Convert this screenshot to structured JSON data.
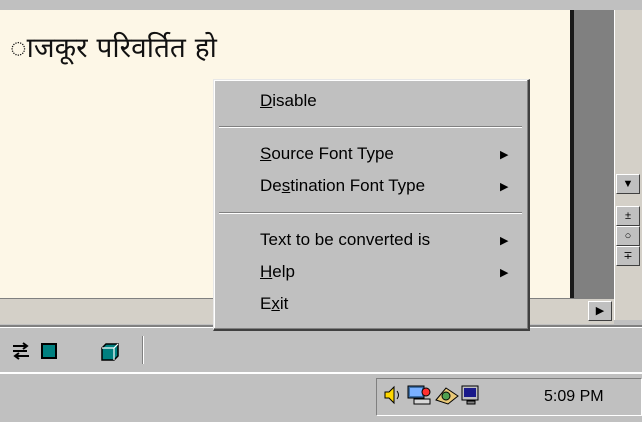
{
  "document": {
    "text": "ाजकूर परिवर्तित हो"
  },
  "context_menu": {
    "items": [
      {
        "label": "Disable",
        "submenu": false
      },
      {
        "label": "Source Font Type",
        "submenu": true
      },
      {
        "label": "Destination Font Type",
        "submenu": true
      },
      {
        "label": "Text to be converted is",
        "submenu": true
      },
      {
        "label": "Help",
        "submenu": true
      },
      {
        "label": "Exit",
        "submenu": false
      }
    ]
  },
  "scrollbar": {
    "down_glyph": "▼",
    "page_up_glyph": "±",
    "select_glyph": "○",
    "page_down_glyph": "∓",
    "right_glyph": "▶"
  },
  "toolbar": {
    "icons": [
      "swap-arrows-icon",
      "square-icon",
      "cube-icon"
    ]
  },
  "tray": {
    "icons": [
      "speaker-icon",
      "network-computer-icon",
      "keyboard-language-icon",
      "monitor-icon"
    ],
    "clock": "5:09 PM"
  },
  "colors": {
    "document_bg": "#fdf7e7",
    "chrome": "#c0c0c0",
    "teal_icon": "#008080"
  }
}
